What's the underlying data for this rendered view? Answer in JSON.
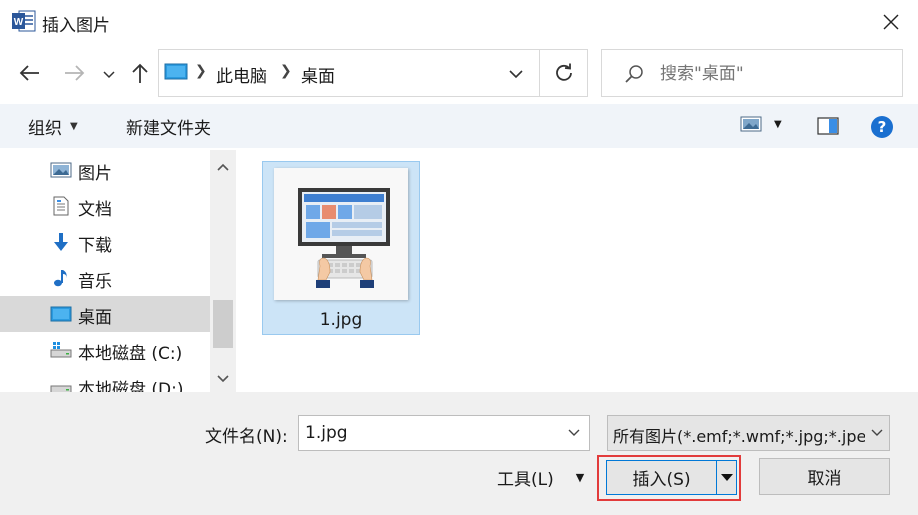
{
  "window": {
    "title": "插入图片",
    "app_icon": "word-icon",
    "close_icon": "close-icon"
  },
  "address": {
    "crumbs": [
      "此电脑",
      "桌面"
    ],
    "location_icon": "monitor-icon"
  },
  "search": {
    "placeholder": "搜索\"桌面\""
  },
  "toolbar": {
    "organize_label": "组织",
    "new_folder_label": "新建文件夹",
    "help_label": "?"
  },
  "nav": {
    "items": [
      {
        "label": "图片",
        "icon": "pictures-icon"
      },
      {
        "label": "文档",
        "icon": "documents-icon"
      },
      {
        "label": "下载",
        "icon": "download-icon"
      },
      {
        "label": "音乐",
        "icon": "music-icon"
      },
      {
        "label": "桌面",
        "icon": "desktop-icon",
        "selected": true
      },
      {
        "label": "本地磁盘 (C:)",
        "icon": "drive-c-icon"
      },
      {
        "label": "本地磁盘 (D:)",
        "icon": "drive-d-icon"
      }
    ]
  },
  "files": [
    {
      "name": "1.jpg",
      "selected": true
    }
  ],
  "footer": {
    "filename_label": "文件名(N):",
    "filename_value": "1.jpg",
    "filetype_value": "所有图片(*.emf;*.wmf;*.jpg;*.jpeg;*.jfif;*.jpe;*.png;*.bmp;*.dib;*.rle;*.gif;*.emz;*.wmz;*.tif;*.tiff;*.svg;*.ico)",
    "tools_label": "工具(L)",
    "insert_label": "插入(S)",
    "cancel_label": "取消"
  },
  "colors": {
    "accent": "#0078d7",
    "highlight_outline": "#e23b3b",
    "selection": "#cce4f7"
  }
}
